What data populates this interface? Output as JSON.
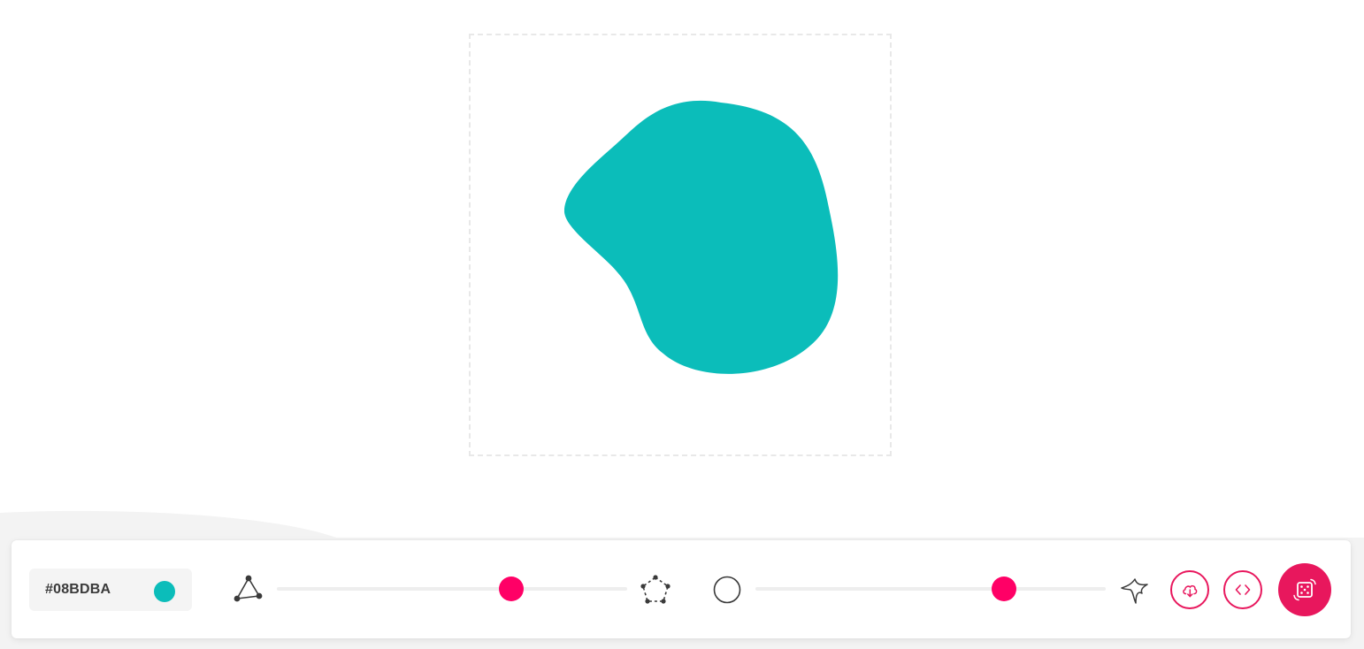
{
  "colors": {
    "blob_fill": "#0BBDBA",
    "accent": "#FF0066",
    "accent_button": "#E8175D",
    "icon_stroke": "#3a3a3a"
  },
  "color_picker": {
    "hex_label": "#08BDBA",
    "swatch": "#0BBDBA"
  },
  "complexity_slider": {
    "value": 0.67,
    "min_icon": "triangle-nodes-icon",
    "max_icon": "pentagon-nodes-icon"
  },
  "contrast_slider": {
    "value": 0.71,
    "min_icon": "circle-icon",
    "max_icon": "spiky-star-icon"
  },
  "actions": {
    "download_icon": "cloud-download-icon",
    "code_icon": "code-brackets-icon",
    "random_icon": "dice-icon"
  }
}
